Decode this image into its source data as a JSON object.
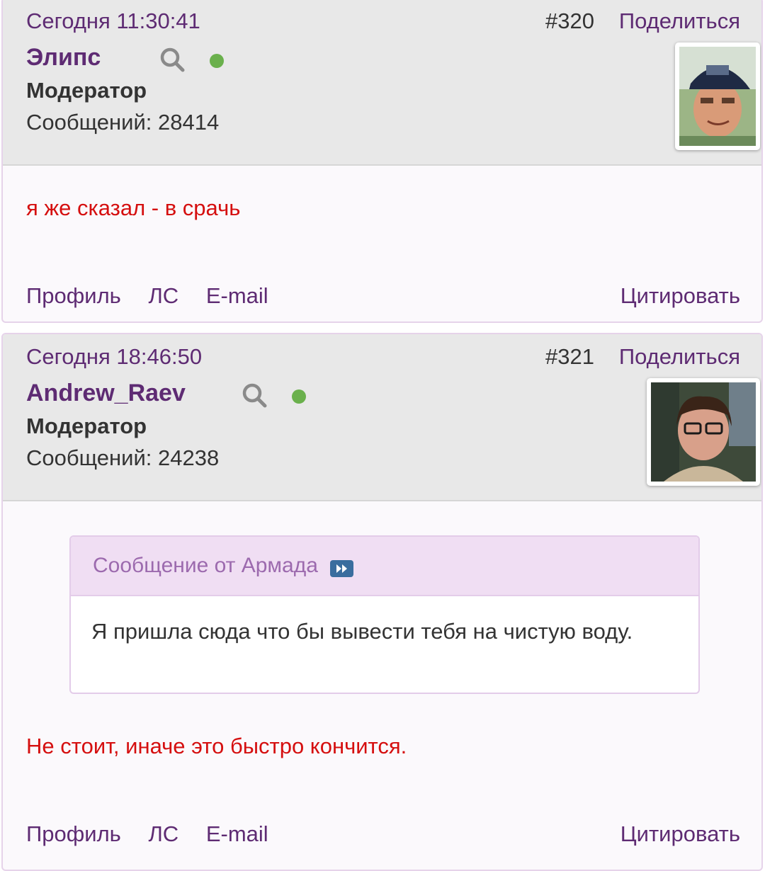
{
  "posts": [
    {
      "date": "Сегодня 11:30:41",
      "number": "#320",
      "share_label": "Поделиться",
      "author": "Элипс",
      "role": "Модератор",
      "messages": "Сообщений: 28414",
      "text": "я же сказал - в срачь",
      "links": {
        "profile": "Профиль",
        "pm": "ЛС",
        "email": "E-mail",
        "quote": "Цитировать"
      }
    },
    {
      "date": "Сегодня 18:46:50",
      "number": "#321",
      "share_label": "Поделиться",
      "author": "Andrew_Raev",
      "role": "Модератор",
      "messages": "Сообщений: 24238",
      "quote": {
        "header": "Сообщение от Армада",
        "text": "Я пришла сюда что бы вывести тебя на чистую воду."
      },
      "text": "Не стоит, иначе это быстро кончится.",
      "links": {
        "profile": "Профиль",
        "pm": "ЛС",
        "email": "E-mail",
        "quote": "Цитировать"
      }
    }
  ],
  "colors": {
    "accent": "#5e2b73",
    "post_text": "#d50f0f",
    "online": "#6ab04c",
    "header_bg": "#e8e8e8",
    "quote_header_bg": "#f0def3"
  },
  "icons": [
    "search-icon",
    "online-indicator",
    "goto-post-icon"
  ]
}
